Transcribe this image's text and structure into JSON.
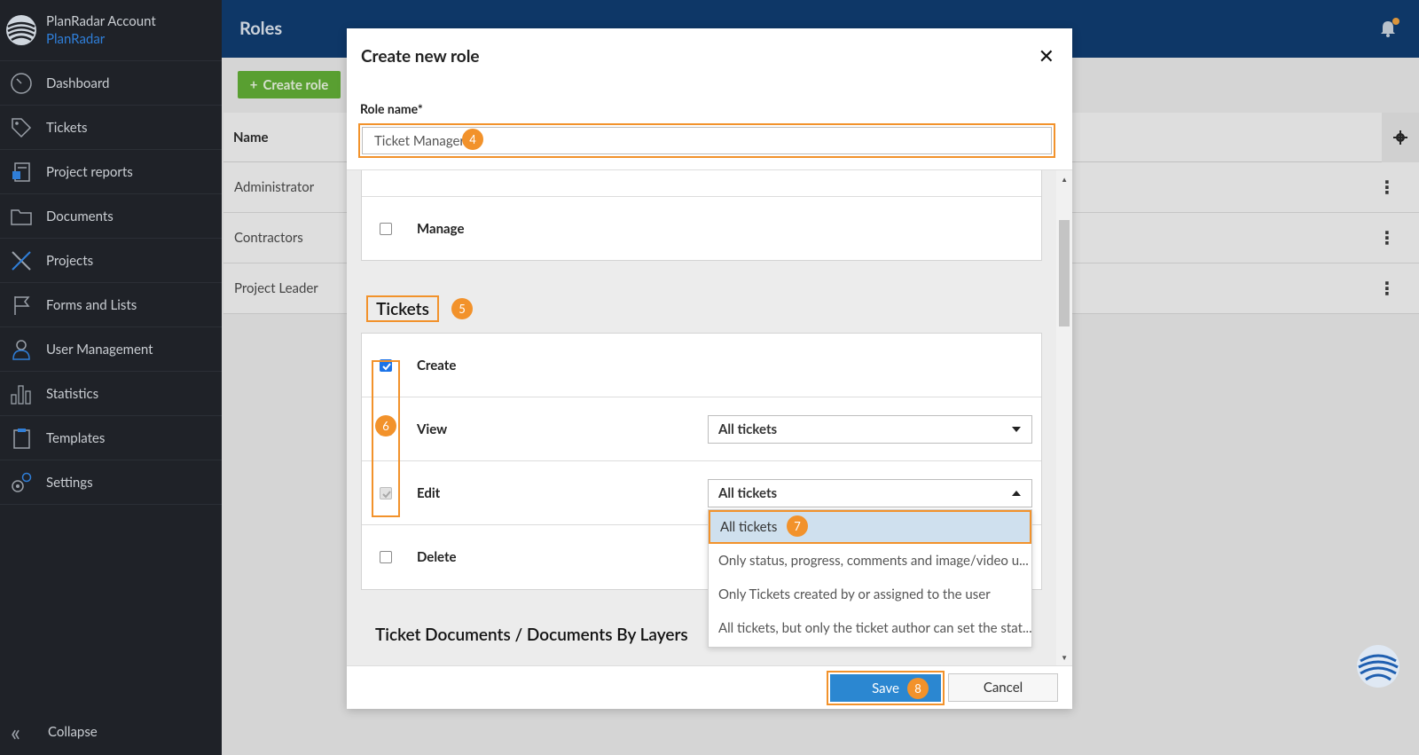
{
  "sidebar": {
    "account_label": "PlanRadar Account",
    "company_label": "PlanRadar",
    "items": [
      {
        "label": "Dashboard",
        "icon": "dashboard-icon"
      },
      {
        "label": "Tickets",
        "icon": "tag-icon"
      },
      {
        "label": "Project reports",
        "icon": "report-icon"
      },
      {
        "label": "Documents",
        "icon": "folder-icon"
      },
      {
        "label": "Projects",
        "icon": "ruler-pencil-icon"
      },
      {
        "label": "Forms and Lists",
        "icon": "flag-icon"
      },
      {
        "label": "User Management",
        "icon": "user-icon"
      },
      {
        "label": "Statistics",
        "icon": "bar-chart-icon"
      },
      {
        "label": "Templates",
        "icon": "clipboard-icon"
      },
      {
        "label": "Settings",
        "icon": "gears-icon"
      }
    ],
    "collapse_label": "Collapse"
  },
  "topbar": {
    "title": "Roles"
  },
  "content": {
    "create_role_label": "Create role",
    "table_header_name": "Name",
    "rows": [
      "Administrator",
      "Contractors",
      "Project Leader"
    ]
  },
  "modal": {
    "title": "Create new role",
    "role_name_label": "Role name*",
    "role_name_value": "Ticket Manager",
    "manage_label": "Manage",
    "section_tickets": "Tickets",
    "permissions": {
      "create": {
        "label": "Create",
        "checked": true
      },
      "view": {
        "label": "View",
        "checked": true,
        "value": "All tickets"
      },
      "edit": {
        "label": "Edit",
        "checked": true,
        "value": "All tickets"
      },
      "delete": {
        "label": "Delete",
        "checked": false
      }
    },
    "dropdown_options": [
      "All tickets",
      "Only status, progress, comments and image/video u...",
      "Only Tickets created by or assigned to the user",
      "All tickets, but only the ticket author can set the stat..."
    ],
    "section_ticket_documents": "Ticket Documents / Documents By Layers",
    "save_label": "Save",
    "cancel_label": "Cancel"
  },
  "steps": {
    "s4": "4",
    "s5": "5",
    "s6": "6",
    "s7": "7",
    "s8": "8"
  },
  "colors": {
    "sidebar_bg": "#1f2228",
    "topbar_bg": "#06356c",
    "accent_orange": "#f2922b",
    "save_blue": "#2b87d1",
    "create_green": "#5cab2e"
  }
}
